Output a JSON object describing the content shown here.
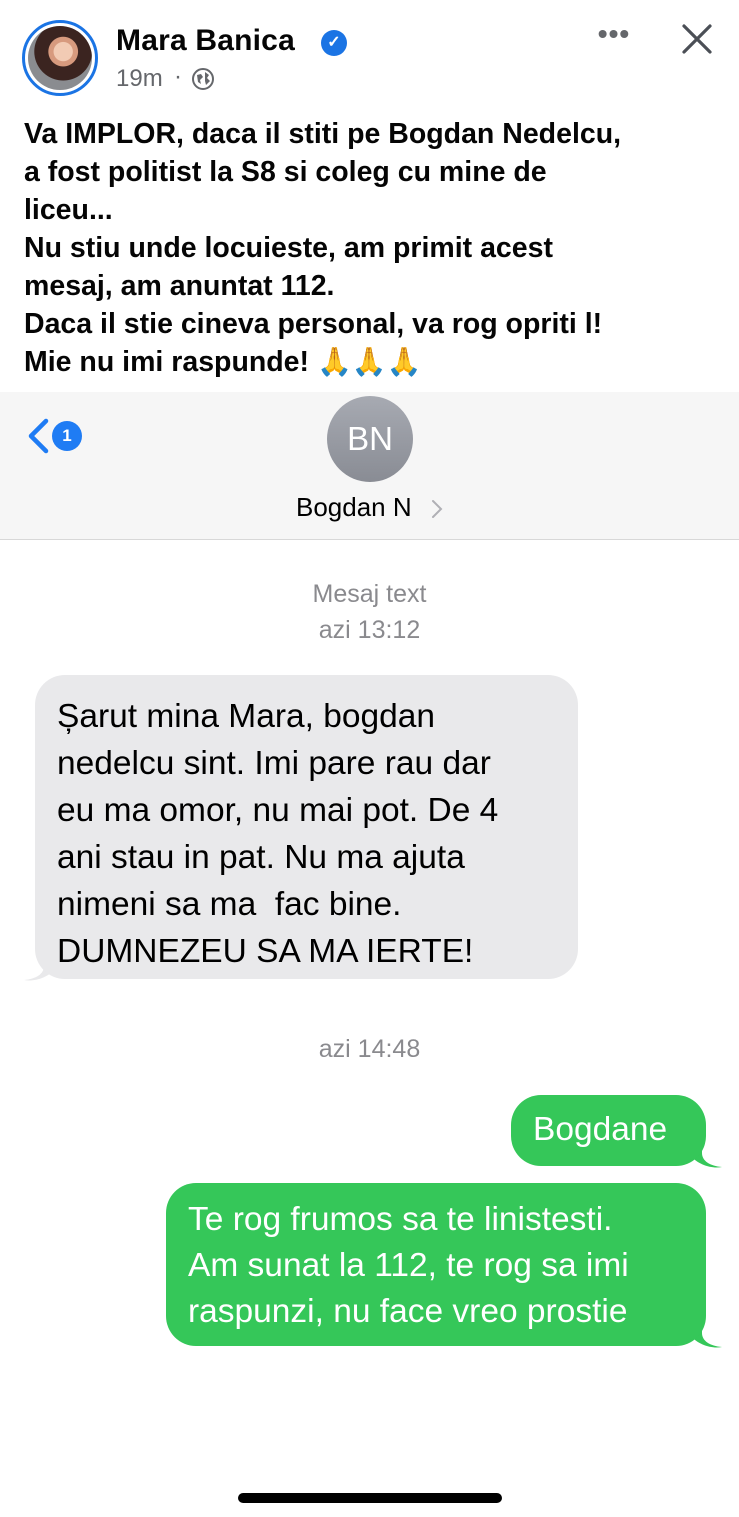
{
  "post": {
    "author": "Mara Banica",
    "time": "19m",
    "dot": "·",
    "verified_icon": "verified-badge-icon",
    "privacy_icon": "globe-icon",
    "more_icon": "more-icon",
    "close_icon": "close-icon",
    "text_lines": [
      "Va IMPLOR, daca il stiti pe Bogdan Nedelcu,",
      "a fost politist la S8 si coleg cu mine de",
      "liceu...",
      "Nu stiu unde locuieste, am primit acest",
      "mesaj, am anuntat 112.",
      "Daca il stie cineva personal, va rog opriti l!",
      "Mie nu imi raspunde!"
    ],
    "emoji": "🙏🙏🙏"
  },
  "conversation": {
    "back_badge": "1",
    "contact_initials": "BN",
    "contact_name": "Bogdan N",
    "service_label": "Mesaj text",
    "timestamp_1": "azi 13:12",
    "incoming_lines": [
      "Șarut mina Mara, bogdan",
      "nedelcu sint. Imi pare rau dar",
      "eu ma omor, nu mai pot. De 4",
      "ani stau in pat. Nu ma ajuta",
      "nimeni sa ma  fac bine.",
      "DUMNEZEU SA MA IERTE!"
    ],
    "timestamp_2": "azi 14:48",
    "outgoing_1": "Bogdane",
    "outgoing_2_lines": [
      "Te rog frumos sa te linistesti.",
      "Am sunat la 112, te rog sa imi",
      "raspunzi, nu face vreo prostie"
    ]
  },
  "colors": {
    "facebook_blue": "#1b74e4",
    "imessage_gray": "#e9e9eb",
    "sms_green": "#35c759"
  }
}
